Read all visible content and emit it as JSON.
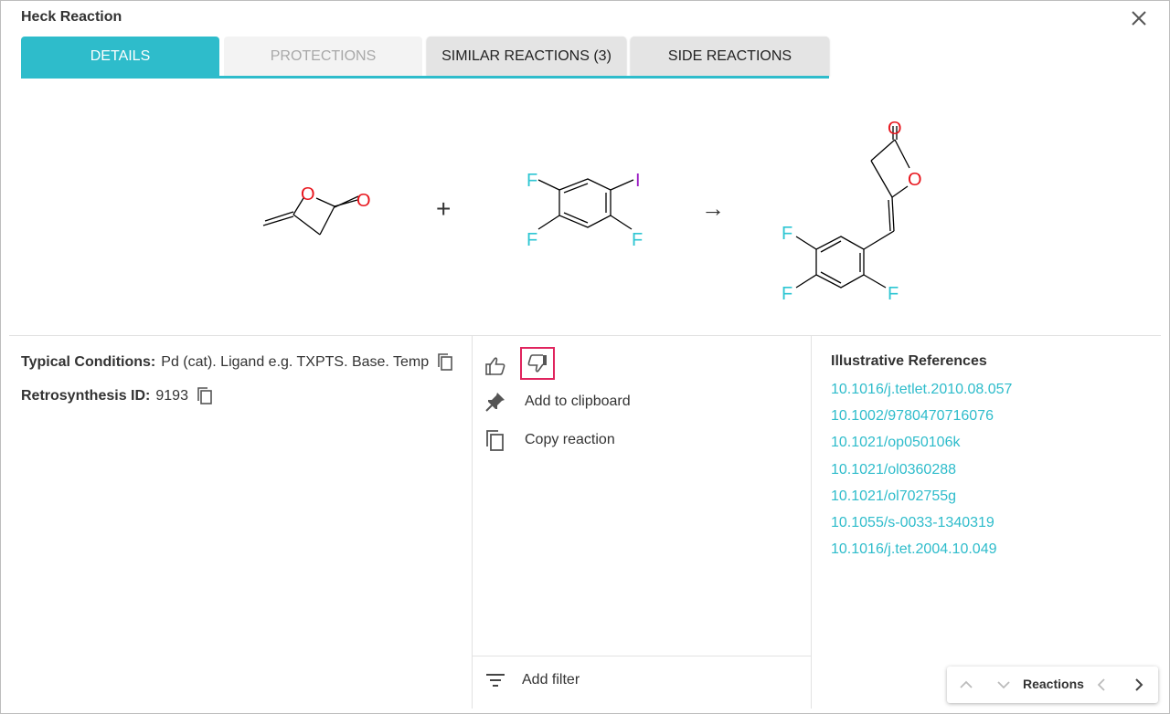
{
  "dialog": {
    "title": "Heck Reaction"
  },
  "tabs": [
    {
      "label": "DETAILS",
      "state": "active"
    },
    {
      "label": "PROTECTIONS",
      "state": "disabled"
    },
    {
      "label": "SIMILAR REACTIONS (3)",
      "state": "normal"
    },
    {
      "label": "SIDE REACTIONS",
      "state": "normal"
    }
  ],
  "reaction": {
    "plus": "+",
    "arrow": "→",
    "atoms": {
      "oxygen": "O",
      "fluorine": "F",
      "iodine": "I"
    }
  },
  "conditions": {
    "typical_label": "Typical Conditions:",
    "typical_value": "Pd (cat). Ligand e.g. TXPTS. Base. Temp",
    "retro_label": "Retrosynthesis ID:",
    "retro_value": "9193"
  },
  "actions": {
    "add_to_clipboard": "Add to clipboard",
    "copy_reaction": "Copy reaction",
    "add_filter": "Add filter"
  },
  "references": {
    "title": "Illustrative References",
    "items": [
      "10.1016/j.tetlet.2010.08.057",
      "10.1002/9780470716076",
      "10.1021/op050106k",
      "10.1021/ol0360288",
      "10.1021/ol702755g",
      "10.1055/s-0033-1340319",
      "10.1016/j.tet.2004.10.049"
    ]
  },
  "navigator": {
    "label": "Reactions"
  },
  "colors": {
    "accent": "#2ebccb",
    "oxygen": "#e8141c",
    "fluorine": "#2ec6d3",
    "iodine": "#9a1bc4",
    "highlight_border": "#e0245e"
  }
}
